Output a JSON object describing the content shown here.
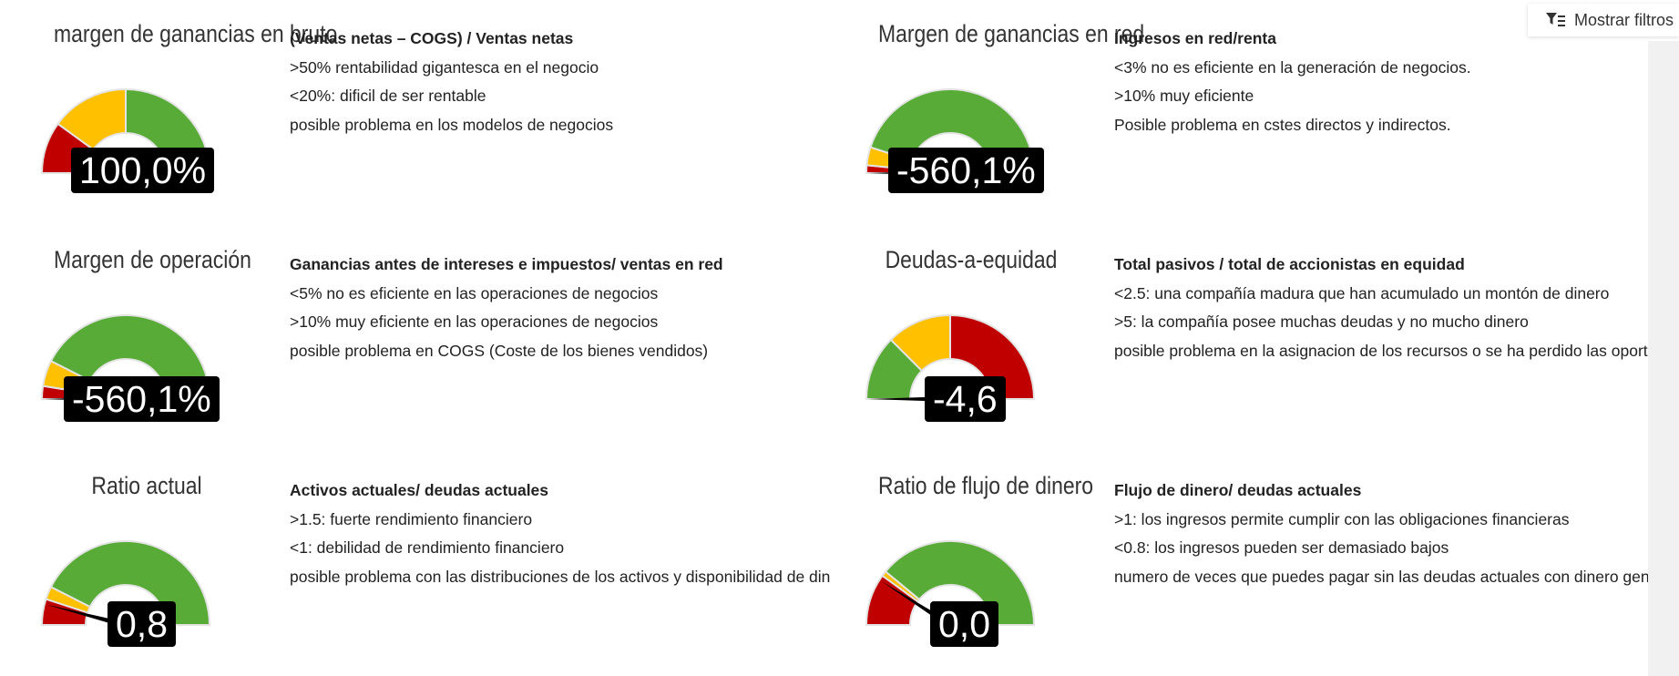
{
  "toolbar": {
    "filters_label": "Mostrar filtros"
  },
  "colors": {
    "red": "#c00000",
    "yellow": "#ffc000",
    "green": "#57ab36"
  },
  "gauges": [
    {
      "title": "margen de ganancias en bruto",
      "value_label": "100,0%",
      "bands": [
        0.2,
        0.5
      ],
      "needle": 1.0,
      "description": {
        "heading": "(Ventas netas  – COGS) / Ventas netas",
        "lines": [
          ">50% rentabilidad gigantesca en el negocio",
          "<20%: dificil de ser rentable",
          "posible problema en los modelos de negocios"
        ]
      }
    },
    {
      "title": "Margen de ganancias en red",
      "value_label": "-560,1%",
      "bands": [
        0.03,
        0.1
      ],
      "needle": 0.0,
      "description": {
        "heading": "Ingresos en red/renta",
        "lines": [
          "<3% no es eficiente en la generación de negocios.",
          ">10% muy eficiente",
          "Posible problema en cstes directos y indirectos."
        ]
      }
    },
    {
      "title": "Margen de operación",
      "value_label": "-560,1%",
      "bands": [
        0.05,
        0.15
      ],
      "needle": 0.0,
      "description": {
        "heading": "Ganancias antes de intereses e impuestos/ ventas en red",
        "lines": [
          "<5% no es eficiente en las operaciones de negocios",
          ">10% muy eficiente en las operaciones de negocios",
          "posible problema en COGS (Coste de los bienes vendidos)"
        ]
      }
    },
    {
      "title": "Deudas-a-equidad",
      "value_label": "-4,6",
      "bands": [
        0.25,
        0.5
      ],
      "reverse": true,
      "needle": 0.0,
      "description": {
        "heading": "Total pasivos / total de accionistas en equidad",
        "lines": [
          "<2.5: una compañía madura que han acumulado un montón de dinero",
          ">5: la compañía posee muchas deudas y no mucho dinero",
          "posible problema en la asignacion de los recursos o se ha perdido las oportu"
        ]
      }
    },
    {
      "title": "Ratio actual",
      "value_label": "0,8",
      "bands": [
        0.1,
        0.15
      ],
      "needle": 0.08,
      "description": {
        "heading": "Activos actuales/ deudas actuales",
        "lines": [
          ">1.5: fuerte rendimiento financiero",
          "<1: debilidad de rendimiento financiero",
          "posible problema con las distribuciones de los activos y disponibilidad de din"
        ]
      }
    },
    {
      "title": "Ratio de flujo de dinero",
      "value_label": "0,0",
      "bands": [
        0.2,
        0.22
      ],
      "needle": 0.18,
      "description": {
        "heading": "Flujo de dinero/ deudas actuales",
        "lines": [
          ">1: los ingresos permite cumplir con las obligaciones financieras",
          "<0.8: los ingresos pueden ser demasiado bajos",
          "numero de veces que puedes pagar sin las deudas actuales con dinero gene"
        ]
      }
    }
  ]
}
